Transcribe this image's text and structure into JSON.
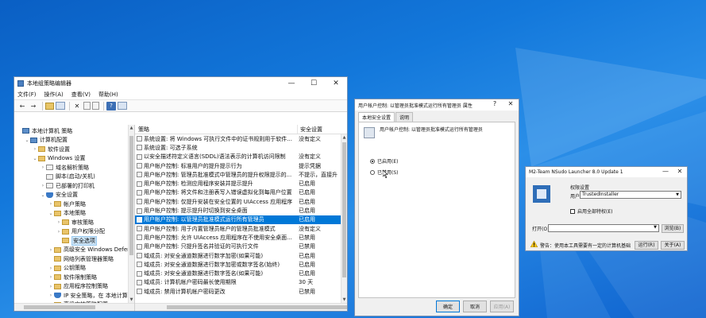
{
  "colors": {
    "desktop": "#1378db",
    "selection": "#0078d7"
  },
  "gpedit": {
    "title": "本地组策略编辑器",
    "menu": [
      "文件(F)",
      "操作(A)",
      "查看(V)",
      "帮助(H)"
    ],
    "tree": [
      {
        "label": "本地计算机 策略",
        "icon": "pc",
        "indent": 0,
        "chev": ""
      },
      {
        "label": "计算机配置",
        "icon": "pc",
        "indent": 1,
        "chev": "⌄"
      },
      {
        "label": "软件设置",
        "icon": "folder",
        "indent": 2,
        "chev": "›"
      },
      {
        "label": "Windows 设置",
        "icon": "folder",
        "indent": 2,
        "chev": "⌄"
      },
      {
        "label": "域名解析策略",
        "icon": "pol",
        "indent": 3,
        "chev": "›"
      },
      {
        "label": "脚本(启动/关机)",
        "icon": "pol",
        "indent": 3,
        "chev": ""
      },
      {
        "label": "已部署的打印机",
        "icon": "pol",
        "indent": 3,
        "chev": "›"
      },
      {
        "label": "安全设置",
        "icon": "shield",
        "indent": 3,
        "chev": "⌄"
      },
      {
        "label": "帐户策略",
        "icon": "folder",
        "indent": 4,
        "chev": "›"
      },
      {
        "label": "本地策略",
        "icon": "folder",
        "indent": 4,
        "chev": "⌄"
      },
      {
        "label": "审核策略",
        "icon": "folder",
        "indent": 5,
        "chev": "›"
      },
      {
        "label": "用户权限分配",
        "icon": "folder",
        "indent": 5,
        "chev": "›"
      },
      {
        "label": "安全选项",
        "icon": "folder",
        "indent": 5,
        "chev": "",
        "selected": true
      },
      {
        "label": "高级安全 Windows Defen",
        "icon": "folder",
        "indent": 4,
        "chev": "›"
      },
      {
        "label": "网络列表管理器策略",
        "icon": "folder",
        "indent": 4,
        "chev": ""
      },
      {
        "label": "公钥策略",
        "icon": "folder",
        "indent": 4,
        "chev": "›"
      },
      {
        "label": "软件限制策略",
        "icon": "folder",
        "indent": 4,
        "chev": "›"
      },
      {
        "label": "应用程序控制策略",
        "icon": "folder",
        "indent": 4,
        "chev": "›"
      },
      {
        "label": "IP 安全策略，在 本地计算",
        "icon": "shield",
        "indent": 4,
        "chev": "›"
      },
      {
        "label": "高级审核策略配置",
        "icon": "folder",
        "indent": 4,
        "chev": "›"
      }
    ],
    "columns": {
      "policy": "策略",
      "setting": "安全设置"
    },
    "rows": [
      {
        "policy": "系统设置: 将 Windows 可执行文件中的证书规则用于软件...",
        "setting": "没有定义"
      },
      {
        "policy": "系统设置: 可选子系统",
        "setting": ""
      },
      {
        "policy": "以安全描述符定义语言(SDDL)语法表示的计算机访问限制",
        "setting": "没有定义"
      },
      {
        "policy": "用户帐户控制: 标准用户的提升提示行为",
        "setting": "提示凭据"
      },
      {
        "policy": "用户帐户控制: 管理员批准模式中管理员的提升权限提示的...",
        "setting": "不提示，直接升"
      },
      {
        "policy": "用户帐户控制: 检测应用程序安装并提示提升",
        "setting": "已启用"
      },
      {
        "policy": "用户帐户控制: 将文件和注册表写入错误虚拟化到每用户位置",
        "setting": "已启用"
      },
      {
        "policy": "用户帐户控制: 仅提升安装在安全位置的 UIAccess 应用程序",
        "setting": "已启用"
      },
      {
        "policy": "用户帐户控制: 提示提升时切换到安全桌面",
        "setting": "已启用"
      },
      {
        "policy": "用户帐户控制: 以管理员批准模式运行所有管理员",
        "setting": "已启用",
        "selected": true
      },
      {
        "policy": "用户帐户控制: 用于内置管理员帐户的管理员批准模式",
        "setting": "没有定义"
      },
      {
        "policy": "用户帐户控制: 允许 UIAccess 应用程序在不使用安全桌面...",
        "setting": "已禁用"
      },
      {
        "policy": "用户帐户控制: 只提升签名并验证的可执行文件",
        "setting": "已禁用"
      },
      {
        "policy": "域成员: 对安全通道数据进行数字加密(如果可能)",
        "setting": "已启用"
      },
      {
        "policy": "域成员: 对安全通道数据进行数字加密或数字签名(始终)",
        "setting": "已启用"
      },
      {
        "policy": "域成员: 对安全通道数据进行数字签名(如果可能)",
        "setting": "已启用"
      },
      {
        "policy": "域成员: 计算机帐户密码最长使用期限",
        "setting": "30 天"
      },
      {
        "policy": "域成员: 禁用计算机帐户密码更改",
        "setting": "已禁用"
      }
    ]
  },
  "props": {
    "title": "用户帐户控制: 以管理员批准模式运行所有管理员 属性",
    "tabs": [
      "本地安全设置",
      "说明"
    ],
    "policy_name": "用户帐户控制: 以管理员批准模式运行所有管理员",
    "enabled_label": "已启用(E)",
    "disabled_label": "已禁用(S)",
    "ok": "确定",
    "cancel": "取消",
    "apply": "应用(A)"
  },
  "nsudo": {
    "title": "M2-Team NSudo Launcher 8.0 Update 1",
    "group_label": "权限设置",
    "user_label": "用户(U):",
    "user_value": "TrustedInstaller",
    "all_priv_label": "启用全部特权(E)",
    "open_label": "打开(O):",
    "browse": "浏览(B)",
    "warning": "警告：使用本工具需要有一定的计算机基础",
    "run": "运行(R)",
    "about": "关于(A)"
  }
}
